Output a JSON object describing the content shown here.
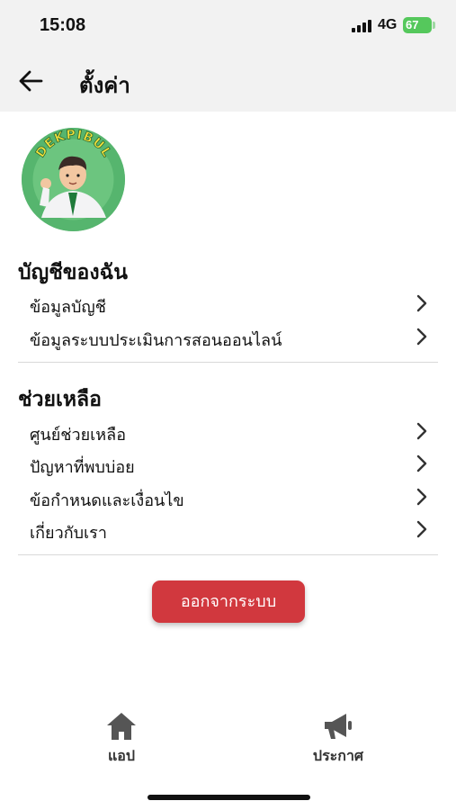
{
  "status_bar": {
    "time": "15:08",
    "network": "4G",
    "battery": "67"
  },
  "header": {
    "title": "ตั้งค่า",
    "back_icon": "arrow-left-icon"
  },
  "avatar": {
    "text": "DEKPIBUL"
  },
  "sections": [
    {
      "title": "บัญชีของฉัน",
      "items": [
        "ข้อมูลบัญชี",
        "ข้อมูลระบบประเมินการสอนออนไลน์"
      ]
    },
    {
      "title": "ช่วยเหลือ",
      "items": [
        "ศูนย์ช่วยเหลือ",
        "ปัญหาที่พบบ่อย",
        "ข้อกำหนดและเงื่อนไข",
        "เกี่ยวกับเรา"
      ]
    }
  ],
  "logout_label": "ออกจากระบบ",
  "tabs": [
    {
      "label": "แอป",
      "icon": "home-icon"
    },
    {
      "label": "ประกาศ",
      "icon": "megaphone-icon"
    }
  ],
  "colors": {
    "accent": "#d1383e",
    "header_bg": "#f2f2f2",
    "battery": "#55c85c"
  }
}
